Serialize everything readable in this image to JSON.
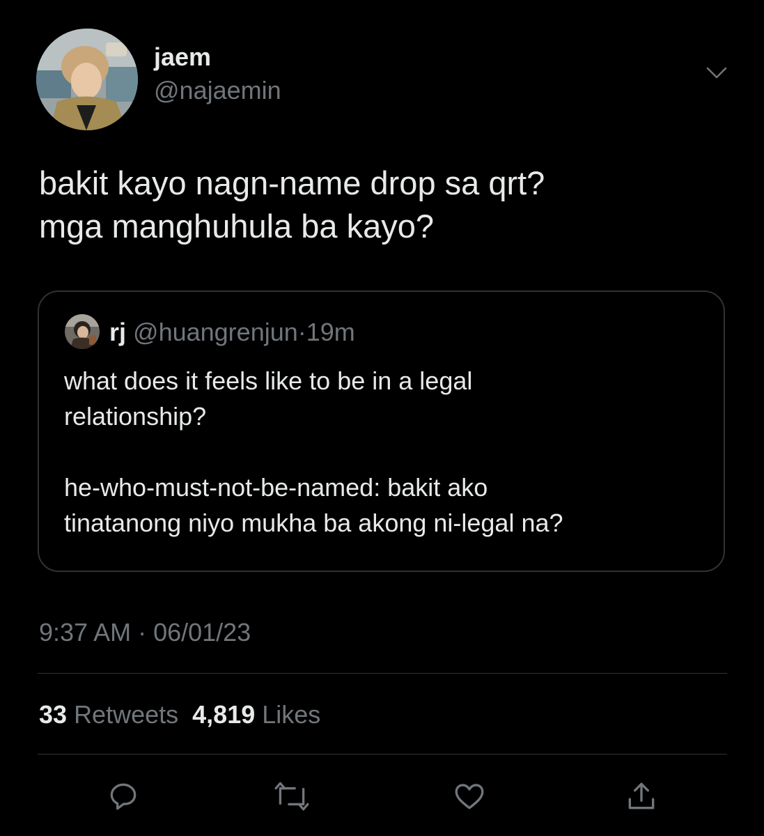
{
  "tweet": {
    "author": {
      "display_name": "jaem",
      "handle": "@najaemin"
    },
    "text_lines": [
      "bakit kayo nagn-name drop sa qrt?",
      "mga manghuhula ba kayo?"
    ],
    "quoted": {
      "display_name": "rj",
      "handle": "@huangrenjun",
      "separator": "·",
      "time": "19m",
      "paragraph1": [
        "what does it feels like to be in a legal",
        "relationship?"
      ],
      "paragraph2": [
        "he-who-must-not-be-named: bakit ako",
        "tinatanong niyo mukha ba akong ni-legal na?"
      ]
    },
    "timestamp": "9:37 AM · 06/01/23",
    "stats": {
      "retweets_count": "33",
      "retweets_label": "Retweets",
      "likes_count": "4,819",
      "likes_label": "Likes"
    }
  },
  "icons": {
    "more": "chevron-down-icon",
    "reply": "reply-icon",
    "retweet": "retweet-icon",
    "like": "heart-icon",
    "share": "share-icon"
  },
  "colors": {
    "background": "#000000",
    "text_primary": "#e7e9ea",
    "text_secondary": "#71767b",
    "border": "#2f3336"
  }
}
